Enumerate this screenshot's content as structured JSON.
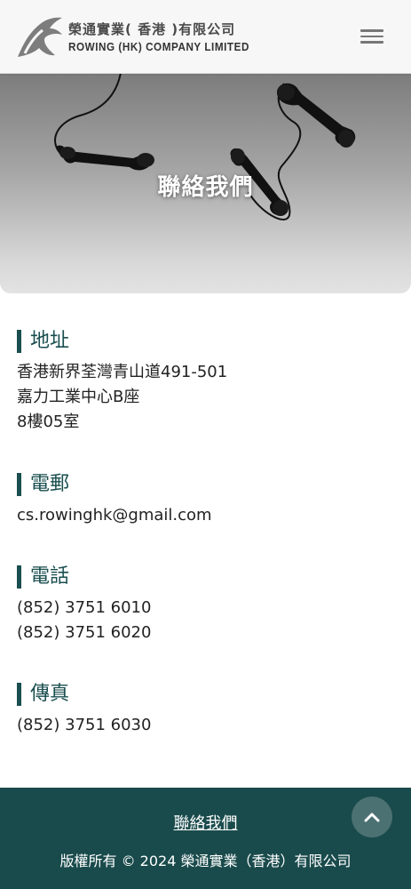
{
  "header": {
    "company_cn": "榮通實業( 香港 )有限公司",
    "company_en": "ROWING (HK) COMPANY LIMITED",
    "logo_icon": "rowing-horse-logo",
    "menu_icon": "hamburger-menu-icon"
  },
  "hero": {
    "title": "聯絡我們"
  },
  "address": {
    "heading": "地址",
    "lines": [
      "香港新界荃灣青山道491-501",
      "嘉力工業中心B座",
      "8樓05室"
    ]
  },
  "email": {
    "heading": "電郵",
    "value": "cs.rowinghk@gmail.com"
  },
  "phone": {
    "heading": "電話",
    "numbers": [
      "(852) 3751 6010",
      "(852) 3751 6020"
    ]
  },
  "fax": {
    "heading": "傳真",
    "number": "(852) 3751 6030"
  },
  "footer": {
    "link": "聯絡我們",
    "copyright": "版權所有 © 2024 榮通實業（香港）有限公司",
    "back_to_top_icon": "chevron-up-icon"
  },
  "colors": {
    "accent": "#1a4e4f",
    "footer_bg": "#1a4b4c",
    "back_to_top_bg": "#4c7172"
  }
}
